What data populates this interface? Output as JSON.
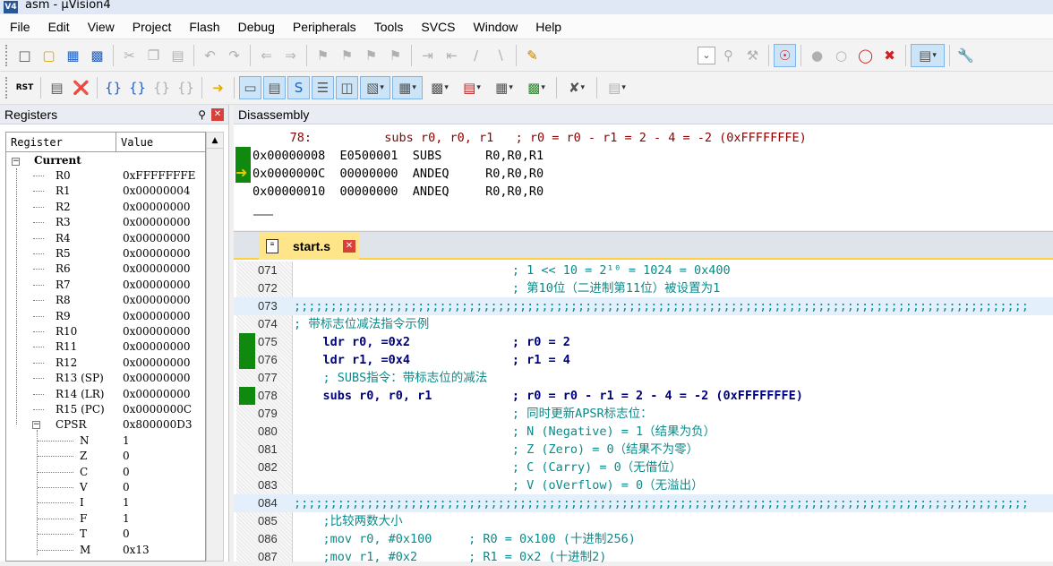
{
  "window": {
    "app_icon": "V4",
    "title": "asm  - µVision4"
  },
  "menu": [
    "File",
    "Edit",
    "View",
    "Project",
    "Flash",
    "Debug",
    "Peripherals",
    "Tools",
    "SVCS",
    "Window",
    "Help"
  ],
  "toolbar2": {
    "rst_label": "RST"
  },
  "registers_panel": {
    "title": "Registers",
    "col_register": "Register",
    "col_value": "Value",
    "group": "Current",
    "rows": [
      {
        "name": "R0",
        "value": "0xFFFFFFFE"
      },
      {
        "name": "R1",
        "value": "0x00000004"
      },
      {
        "name": "R2",
        "value": "0x00000000"
      },
      {
        "name": "R3",
        "value": "0x00000000"
      },
      {
        "name": "R4",
        "value": "0x00000000"
      },
      {
        "name": "R5",
        "value": "0x00000000"
      },
      {
        "name": "R6",
        "value": "0x00000000"
      },
      {
        "name": "R7",
        "value": "0x00000000"
      },
      {
        "name": "R8",
        "value": "0x00000000"
      },
      {
        "name": "R9",
        "value": "0x00000000"
      },
      {
        "name": "R10",
        "value": "0x00000000"
      },
      {
        "name": "R11",
        "value": "0x00000000"
      },
      {
        "name": "R12",
        "value": "0x00000000"
      },
      {
        "name": "R13 (SP)",
        "value": "0x00000000"
      },
      {
        "name": "R14 (LR)",
        "value": "0x00000000"
      },
      {
        "name": "R15 (PC)",
        "value": "0x0000000C"
      },
      {
        "name": "CPSR",
        "value": "0x800000D3"
      }
    ],
    "flags": [
      {
        "name": "N",
        "value": "1"
      },
      {
        "name": "Z",
        "value": "0"
      },
      {
        "name": "C",
        "value": "0"
      },
      {
        "name": "V",
        "value": "0"
      },
      {
        "name": "I",
        "value": "1"
      },
      {
        "name": "F",
        "value": "1"
      },
      {
        "name": "T",
        "value": "0"
      },
      {
        "name": "M",
        "value": "0x13"
      }
    ]
  },
  "disassembly": {
    "title": "Disassembly",
    "lines": [
      "     78:          subs r0, r0, r1   ; r0 = r0 - r1 = 2 - 4 = -2 (0xFFFFFFFE)",
      "0x00000008  E0500001  SUBS      R0,R0,R1",
      "0x0000000C  00000000  ANDEQ     R0,R0,R0",
      "0x00000010  00000000  ANDEQ     R0,R0,R0"
    ]
  },
  "editor": {
    "tab_label": "start.s",
    "lines": [
      {
        "no": "071",
        "text": "                              ; 1 << 10 = 2¹⁰ = 1024 = 0x400"
      },
      {
        "no": "072",
        "text": "                              ; 第10位（二进制第11位）被设置为1"
      },
      {
        "no": "073",
        "text": ";;;;;;;;;;;;;;;;;;;;;;;;;;;;;;;;;;;;;;;;;;;;;;;;;;;;;;;;;;;;;;;;;;;;;;;;;;;;;;;;;;;;;;;;;;;;;;;;;;;;;"
      },
      {
        "no": "074",
        "text": "; 带标志位减法指令示例"
      },
      {
        "no": "075",
        "text": "    ldr r0, =0x2              ; r0 = 2"
      },
      {
        "no": "076",
        "text": "    ldr r1, =0x4              ; r1 = 4"
      },
      {
        "no": "077",
        "text": "    ; SUBS指令：带标志位的减法"
      },
      {
        "no": "078",
        "text": "    subs r0, r0, r1           ; r0 = r0 - r1 = 2 - 4 = -2 (0xFFFFFFFE)"
      },
      {
        "no": "079",
        "text": "                              ; 同时更新APSR标志位："
      },
      {
        "no": "080",
        "text": "                              ; N (Negative) = 1（结果为负）"
      },
      {
        "no": "081",
        "text": "                              ; Z (Zero) = 0（结果不为零）"
      },
      {
        "no": "082",
        "text": "                              ; C (Carry) = 0（无借位）"
      },
      {
        "no": "083",
        "text": "                              ; V (oVerflow) = 0（无溢出）"
      },
      {
        "no": "084",
        "text": ";;;;;;;;;;;;;;;;;;;;;;;;;;;;;;;;;;;;;;;;;;;;;;;;;;;;;;;;;;;;;;;;;;;;;;;;;;;;;;;;;;;;;;;;;;;;;;;;;;;;;"
      },
      {
        "no": "085",
        "text": "    ;比较两数大小"
      },
      {
        "no": "086",
        "text": "    ;mov r0, #0x100     ; R0 = 0x100 (十进制256)"
      },
      {
        "no": "087",
        "text": "    ;mov r1, #0x2       ; R1 = 0x2 (十进制2)"
      }
    ]
  },
  "colors": {
    "green_marker": "#0f8a0f",
    "comment": "#0a8a8a",
    "tab_accent": "#ffcf3f"
  }
}
